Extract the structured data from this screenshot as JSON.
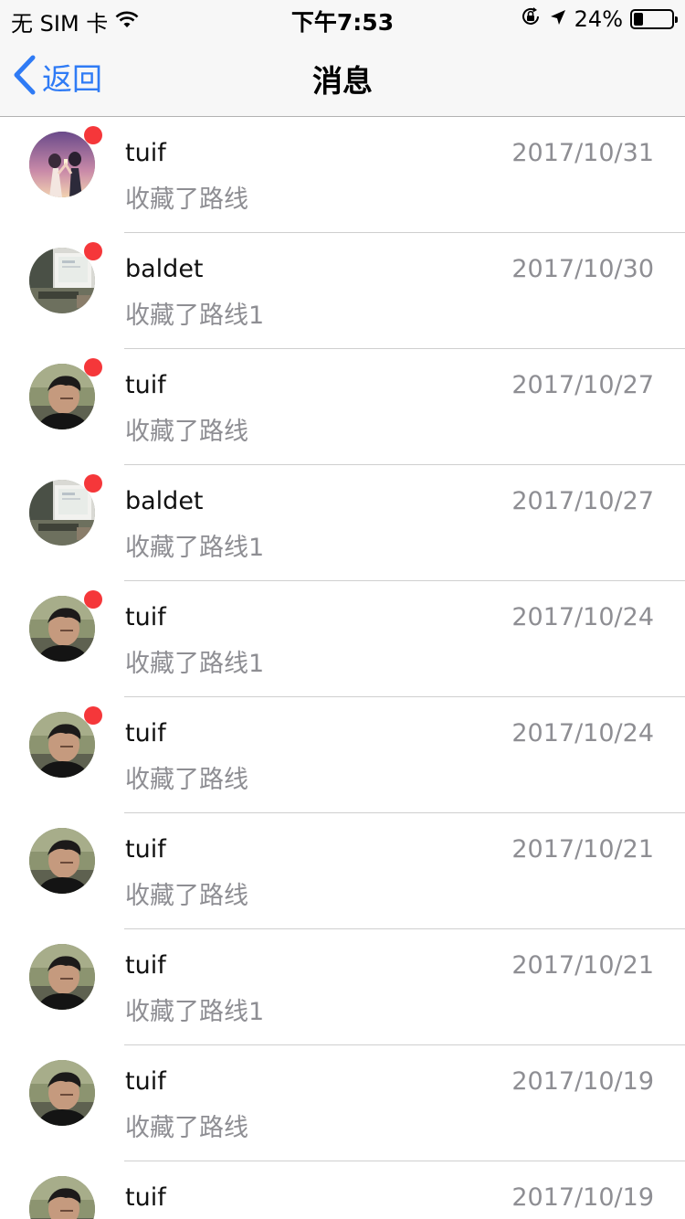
{
  "status_bar": {
    "carrier": "无 SIM 卡",
    "time": "下午7:53",
    "battery_text": "24%",
    "battery_level": 0.24
  },
  "nav": {
    "back_label": "返回",
    "title": "消息"
  },
  "colors": {
    "accent": "#2f7bf5",
    "unread": "#f5373a",
    "secondary_text": "#8e8e93",
    "divider": "#cfcfcf"
  },
  "messages": [
    {
      "name": "tuif",
      "subtitle": "收藏了路线",
      "date": "2017/10/31",
      "unread": true,
      "avatar": "anime-couple-avatar"
    },
    {
      "name": "baldet",
      "subtitle": "收藏了路线1",
      "date": "2017/10/30",
      "unread": true,
      "avatar": "computer-desk-avatar"
    },
    {
      "name": "tuif",
      "subtitle": "收藏了路线",
      "date": "2017/10/27",
      "unread": true,
      "avatar": "man-photo-avatar"
    },
    {
      "name": "baldet",
      "subtitle": "收藏了路线1",
      "date": "2017/10/27",
      "unread": true,
      "avatar": "computer-desk-avatar"
    },
    {
      "name": "tuif",
      "subtitle": "收藏了路线1",
      "date": "2017/10/24",
      "unread": true,
      "avatar": "man-photo-avatar"
    },
    {
      "name": "tuif",
      "subtitle": "收藏了路线",
      "date": "2017/10/24",
      "unread": true,
      "avatar": "man-photo-avatar"
    },
    {
      "name": "tuif",
      "subtitle": "收藏了路线",
      "date": "2017/10/21",
      "unread": false,
      "avatar": "man-photo-avatar"
    },
    {
      "name": "tuif",
      "subtitle": "收藏了路线1",
      "date": "2017/10/21",
      "unread": false,
      "avatar": "man-photo-avatar"
    },
    {
      "name": "tuif",
      "subtitle": "收藏了路线",
      "date": "2017/10/19",
      "unread": false,
      "avatar": "man-photo-avatar"
    },
    {
      "name": "tuif",
      "subtitle": "",
      "date": "2017/10/19",
      "unread": false,
      "avatar": "man-photo-avatar"
    }
  ]
}
